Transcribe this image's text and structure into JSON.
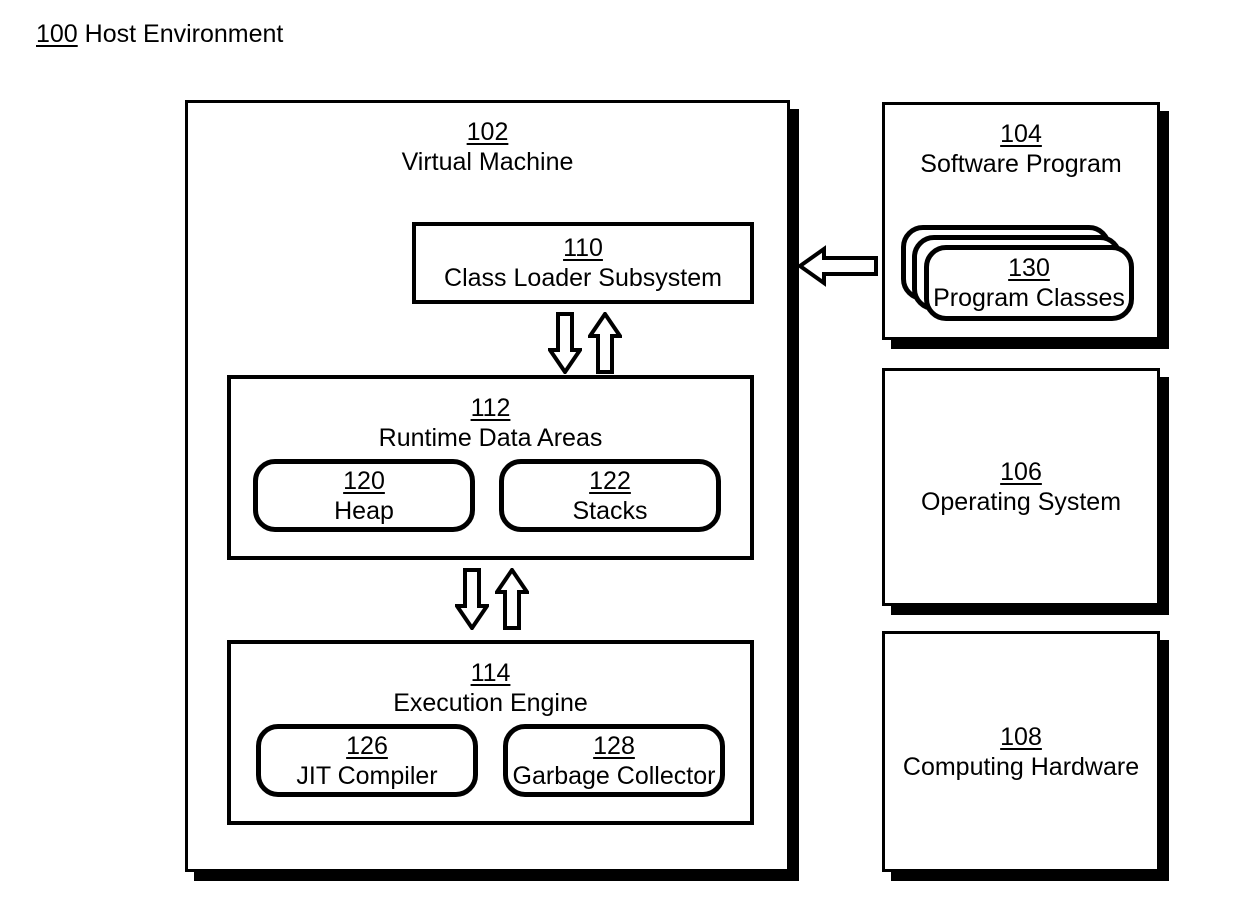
{
  "figure": {
    "ref": "100",
    "title": "Host Environment"
  },
  "virtual_machine": {
    "ref": "102",
    "title": "Virtual Machine",
    "class_loader": {
      "ref": "110",
      "title": "Class Loader Subsystem"
    },
    "runtime_data_areas": {
      "ref": "112",
      "title": "Runtime Data Areas",
      "children": [
        {
          "ref": "120",
          "title": "Heap"
        },
        {
          "ref": "122",
          "title": "Stacks"
        }
      ]
    },
    "execution_engine": {
      "ref": "114",
      "title": "Execution Engine",
      "children": [
        {
          "ref": "126",
          "title": "JIT Compiler"
        },
        {
          "ref": "128",
          "title": "Garbage Collector"
        }
      ]
    }
  },
  "software_program": {
    "ref": "104",
    "title": "Software Program",
    "program_classes": {
      "ref": "130",
      "title": "Program Classes",
      "stack_count": 3
    }
  },
  "operating_system": {
    "ref": "106",
    "title": "Operating System"
  },
  "computing_hardware": {
    "ref": "108",
    "title": "Computing Hardware"
  },
  "arrows": [
    {
      "name": "class-loader-to-runtime-down",
      "direction": "down"
    },
    {
      "name": "runtime-to-class-loader-up",
      "direction": "up"
    },
    {
      "name": "runtime-to-execution-down",
      "direction": "down"
    },
    {
      "name": "execution-to-runtime-up",
      "direction": "up"
    },
    {
      "name": "program-to-vm-left",
      "direction": "left"
    }
  ],
  "colors": {
    "stroke": "#000000",
    "fill": "#ffffff",
    "shadow": "#000000"
  }
}
